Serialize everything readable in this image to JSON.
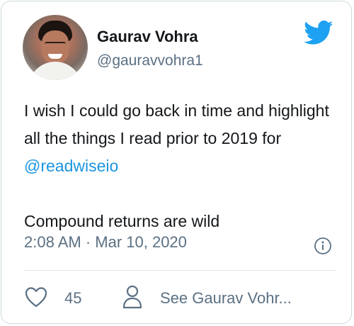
{
  "author": {
    "name": "Gaurav Vohra",
    "handle": "@gauravvohra1"
  },
  "tweet": {
    "line1": "I wish I could go back in time and highlight all the things I read prior to 2019 for ",
    "mention": "@readwiseio",
    "line2": "Compound returns are wild",
    "timestamp": "2:08 AM · Mar 10, 2020"
  },
  "actions": {
    "like_count": "45",
    "profile_link": "See Gaurav Vohr..."
  },
  "colors": {
    "brand": "#1da1f2",
    "mention": "#1b95e0",
    "secondary_text": "#5b7083"
  },
  "icons": [
    "avatar",
    "twitter-bird-icon",
    "info-icon",
    "heart-icon",
    "user-icon"
  ]
}
